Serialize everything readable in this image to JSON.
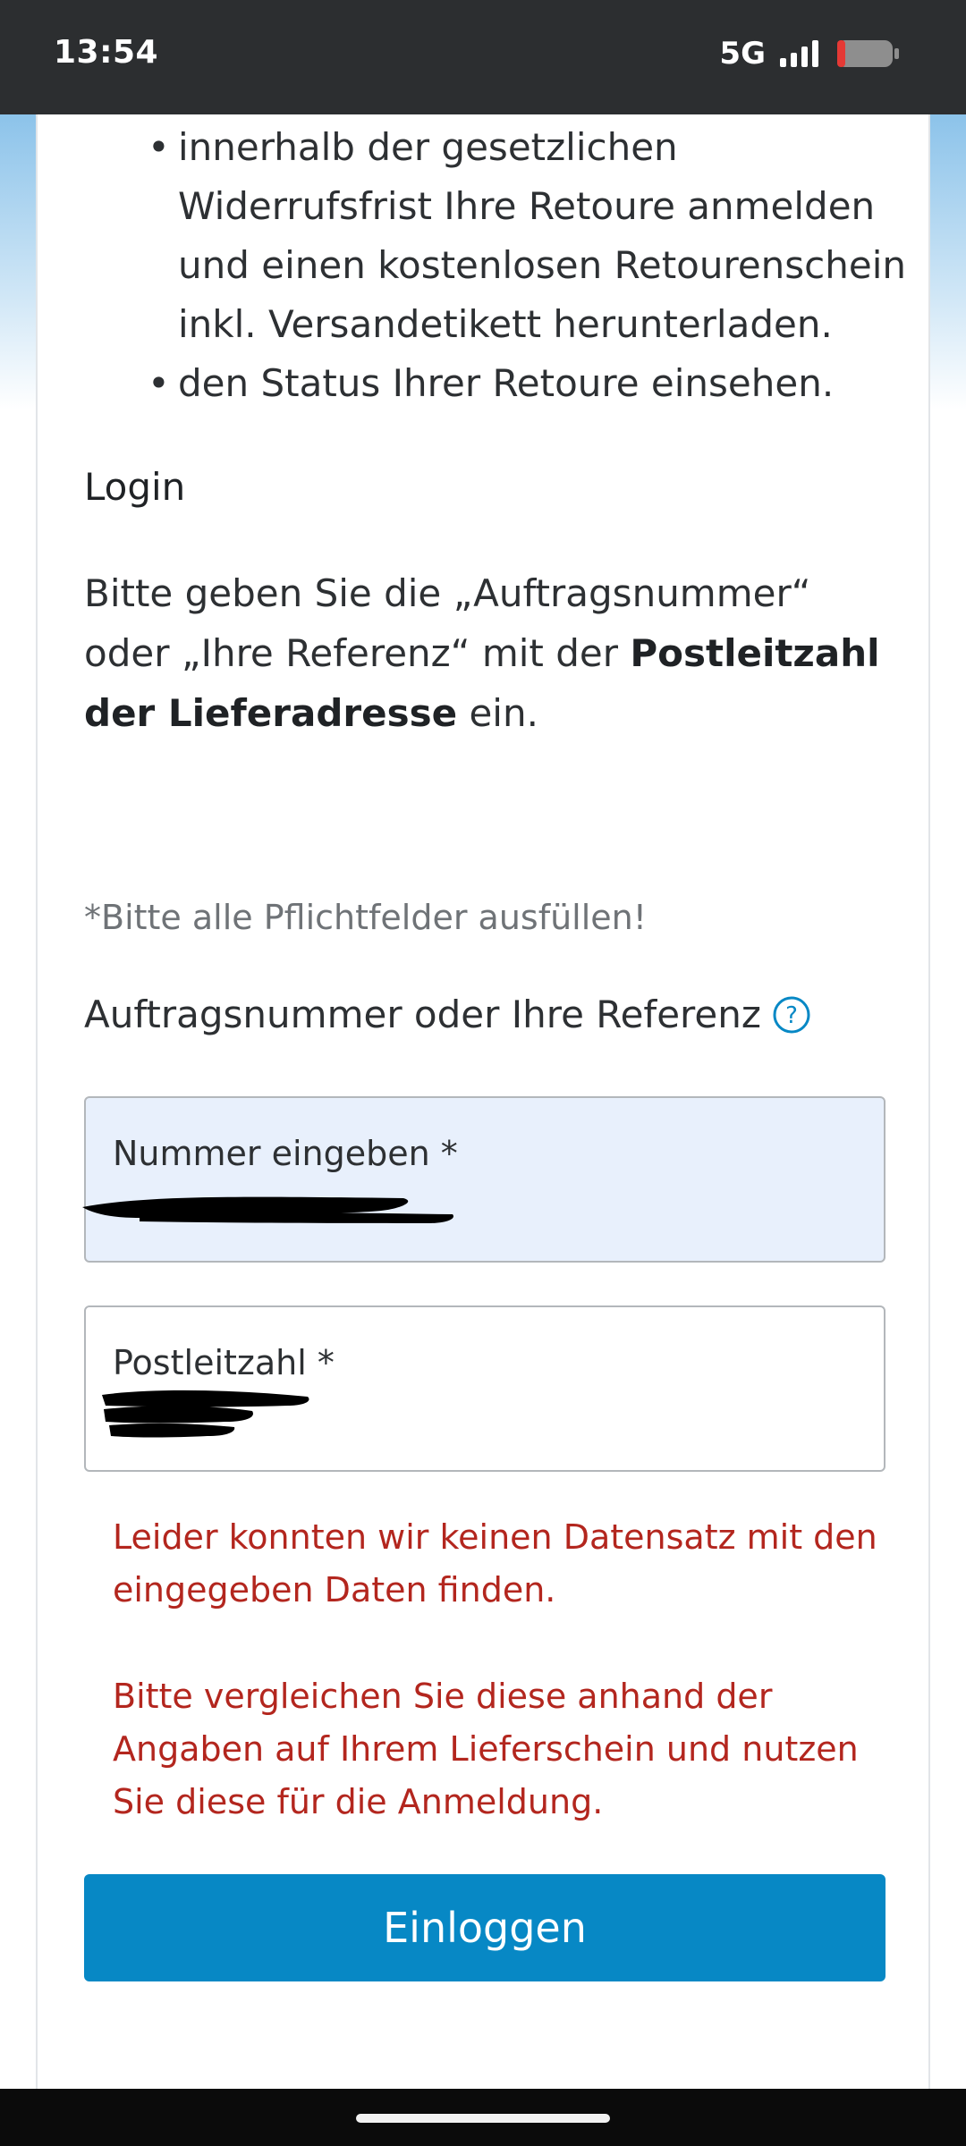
{
  "status_bar": {
    "time": "13:54",
    "network": "5G",
    "signal_icon": "cellular-signal-icon",
    "battery_icon": "battery-low-icon",
    "battery_color": "#e53935"
  },
  "bullets": [
    "innerhalb der gesetzlichen Widerrufsfrist Ihre Retoure anmelden und einen kostenlosen Retourenschein inkl. Versandetikett herunterladen.",
    "den Status Ihrer Retoure einsehen."
  ],
  "login": {
    "heading": "Login",
    "intro_before": "Bitte geben Sie die „Auftragsnummer“ oder „Ihre Referenz“ mit der ",
    "intro_bold": "Postleitzahl der Lieferadresse",
    "intro_after": " ein.",
    "required_note": "*Bitte alle Pflichtfelder ausfüllen!",
    "field_label": "Auftragsnummer oder Ihre Referenz",
    "help_icon": "question-circle-icon",
    "number_label": "Nummer eingeben *",
    "postal_label": "Postleitzahl *",
    "error_1": "Leider konnten wir keinen Datensatz mit den eingegeben Daten finden.",
    "error_2": "Bitte vergleichen Sie diese anhand der Angaben auf Ihrem Lieferschein und nutzen Sie diese für die Anmeldung.",
    "button_label": "Einloggen"
  },
  "colors": {
    "accent": "#0788c5",
    "error": "#b3261e",
    "filled_input_bg": "#e8f0fc"
  }
}
